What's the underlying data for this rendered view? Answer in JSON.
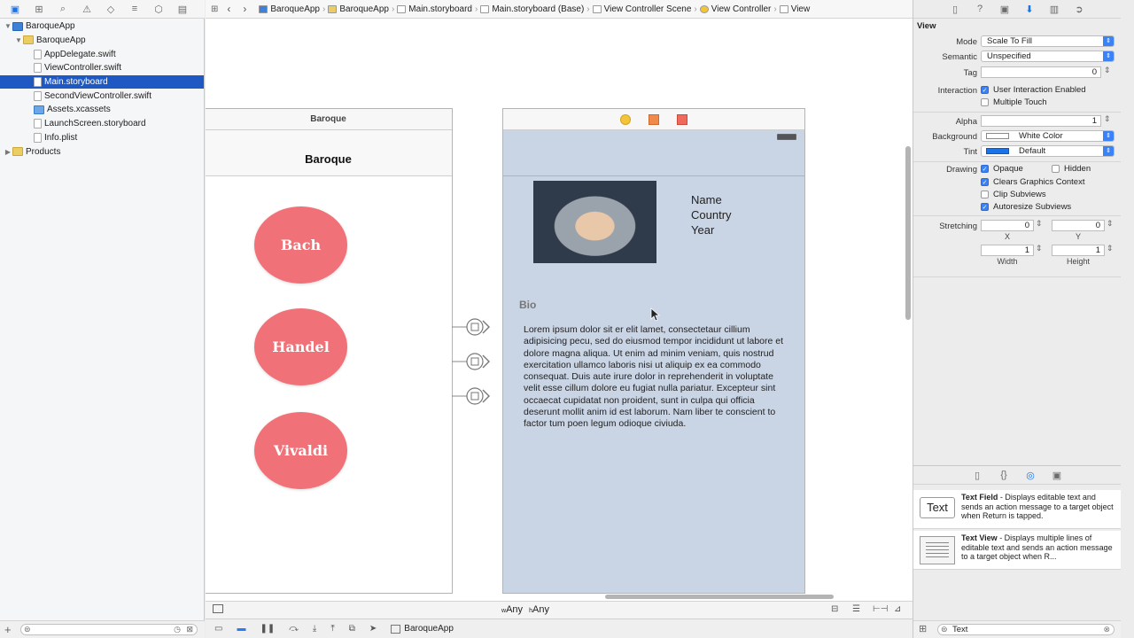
{
  "navigator": {
    "items": [
      {
        "label": "BaroqueApp",
        "kind": "proj",
        "level": 0,
        "disclosure": "▼"
      },
      {
        "label": "BaroqueApp",
        "kind": "folder",
        "level": 1,
        "disclosure": "▼"
      },
      {
        "label": "AppDelegate.swift",
        "kind": "swift",
        "level": 2,
        "disclosure": ""
      },
      {
        "label": "ViewController.swift",
        "kind": "swift",
        "level": 2,
        "disclosure": ""
      },
      {
        "label": "Main.storyboard",
        "kind": "sb",
        "level": 2,
        "disclosure": "",
        "selected": true
      },
      {
        "label": "SecondViewController.swift",
        "kind": "swift",
        "level": 2,
        "disclosure": ""
      },
      {
        "label": "Assets.xcassets",
        "kind": "assets",
        "level": 2,
        "disclosure": ""
      },
      {
        "label": "LaunchScreen.storyboard",
        "kind": "sb",
        "level": 2,
        "disclosure": ""
      },
      {
        "label": "Info.plist",
        "kind": "plist",
        "level": 2,
        "disclosure": ""
      },
      {
        "label": "Products",
        "kind": "folder",
        "level": 0,
        "disclosure": "▶"
      }
    ]
  },
  "jumpbar": {
    "crumbs": [
      "BaroqueApp",
      "BaroqueApp",
      "Main.storyboard",
      "Main.storyboard (Base)",
      "View Controller Scene",
      "View Controller",
      "View"
    ]
  },
  "scene1": {
    "title": "Baroque",
    "nav_title": "Baroque",
    "buttons": [
      "Bach",
      "Handel",
      "Vivaldi"
    ]
  },
  "scene2": {
    "info": [
      "Name",
      "Country",
      "Year"
    ],
    "bio_heading": "Bio",
    "bio_text": "Lorem ipsum dolor sit er elit lamet, consectetaur cillium adipisicing pecu, sed do eiusmod tempor incididunt ut labore et dolore magna aliqua. Ut enim ad minim veniam, quis nostrud exercitation ullamco laboris nisi ut aliquip ex ea commodo consequat. Duis aute irure dolor in reprehenderit in voluptate velit esse cillum dolore eu fugiat nulla pariatur. Excepteur sint occaecat cupidatat non proident, sunt in culpa qui officia deserunt mollit anim id est laborum. Nam liber te conscient to factor tum poen legum odioque civiuda."
  },
  "canvas_bottom": {
    "w_prefix": "w",
    "w_label": "Any",
    "h_prefix": "h",
    "h_label": "Any"
  },
  "debug_bar": {
    "target": "BaroqueApp"
  },
  "inspector": {
    "section": "View",
    "mode_label": "Mode",
    "mode_value": "Scale To Fill",
    "semantic_label": "Semantic",
    "semantic_value": "Unspecified",
    "tag_label": "Tag",
    "tag_value": "0",
    "interaction_label": "Interaction",
    "interaction_items": [
      {
        "label": "User Interaction Enabled",
        "checked": true
      },
      {
        "label": "Multiple Touch",
        "checked": false
      }
    ],
    "alpha_label": "Alpha",
    "alpha_value": "1",
    "background_label": "Background",
    "background_value": "White Color",
    "tint_label": "Tint",
    "tint_value": "Default",
    "drawing_label": "Drawing",
    "opaque_label": "Opaque",
    "hidden_label": "Hidden",
    "clears_label": "Clears Graphics Context",
    "clip_label": "Clip Subviews",
    "autoresize_label": "Autoresize Subviews",
    "stretching_label": "Stretching",
    "stretch_x": "0",
    "stretch_y": "0",
    "stretch_w": "1",
    "stretch_h": "1",
    "x_label": "X",
    "y_label": "Y",
    "width_label": "Width",
    "height_label": "Height"
  },
  "library": {
    "items": [
      {
        "icon_text": "Text",
        "title": "Text Field",
        "desc": " - Displays editable text and sends an action message to a target object when Return is tapped."
      },
      {
        "icon_text": "",
        "title": "Text View",
        "desc": " - Displays multiple lines of editable text and sends an action message to a target object when R..."
      }
    ],
    "filter_value": "Text"
  },
  "colors": {
    "circle_button": "#f07178",
    "detail_background": "#c9d4e4",
    "selection": "#1e58c2",
    "accent": "#3a82f7"
  }
}
